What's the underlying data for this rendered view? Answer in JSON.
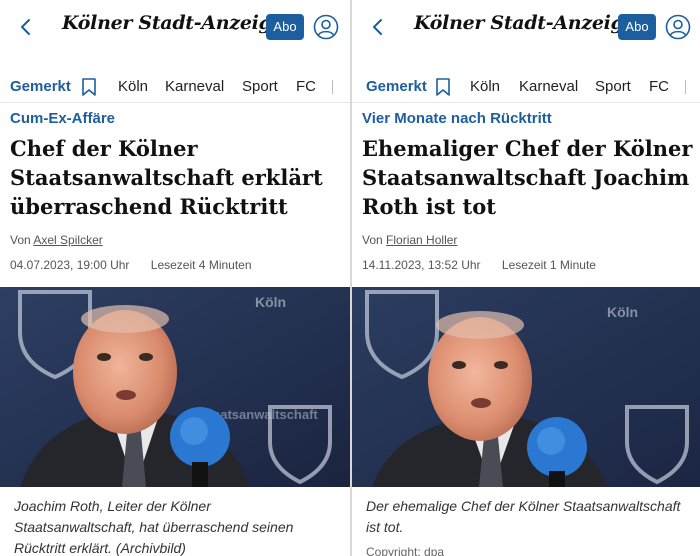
{
  "left": {
    "logo_text": "Kölner Stadt-Anzeiger",
    "abo_label": "Abo",
    "nav": [
      "Gemerkt",
      "Köln",
      "Karneval",
      "Sport",
      "FC"
    ],
    "kicker": "Cum-Ex-Affäre",
    "headline": "Chef der Kölner Staatsanwaltschaft erklärt überraschend Rücktritt",
    "byline_prefix": "Von",
    "author": "Axel Spilcker",
    "date": "04.07.2023, 19:00 Uhr",
    "reading_time": "Lesezeit 4 Minuten",
    "caption": "Joachim Roth, Leiter der Kölner Staatsanwaltschaft, hat überraschend seinen Rücktritt erklärt. (Archivbild)"
  },
  "right": {
    "logo_text": "Kölner Stadt-Anzeiger",
    "abo_label": "Abo",
    "nav": [
      "Gemerkt",
      "Köln",
      "Karneval",
      "Sport",
      "FC"
    ],
    "kicker": "Vier Monate nach Rücktritt",
    "headline": "Ehemaliger Chef der Kölner Staatsanwaltschaft Joachim Roth ist tot",
    "byline_prefix": "Von",
    "author": "Florian Holler",
    "date": "14.11.2023, 13:52 Uhr",
    "reading_time": "Lesezeit 1 Minute",
    "caption": "Der ehemalige Chef der Kölner Staatsanwaltschaft ist tot.",
    "credit": "Copyright: dpa"
  },
  "photo_texts": {
    "wall_text_1": "Köln",
    "wall_text_2": "Staatsanwaltschaft"
  },
  "colors": {
    "accent": "#1c5e9e",
    "photo_bg": "#23324f"
  },
  "icons": {
    "back": "chevron-left-icon",
    "user": "user-circle-icon",
    "bookmark": "bookmark-icon"
  }
}
